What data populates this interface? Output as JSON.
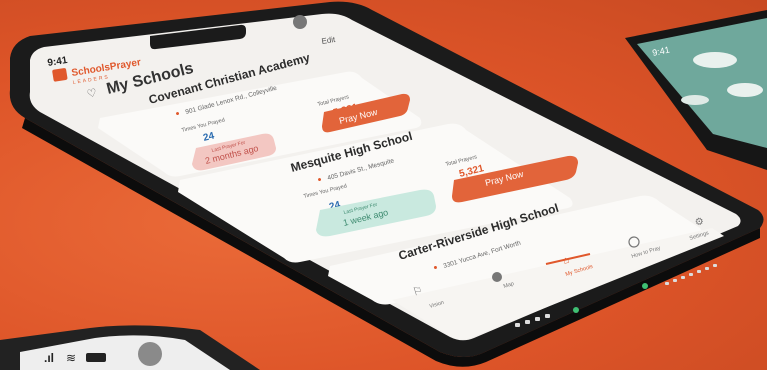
{
  "status_bar": {
    "time": "9:41"
  },
  "app": {
    "brand": "SchoolsPrayer",
    "brand_tagline": "LEADERS",
    "edit_label": "Edit",
    "header": "My Schools"
  },
  "schools": [
    {
      "name": "Covenant Christian Academy",
      "address": "901 Glade Lenox Rd., Colleyville",
      "total_prayers_label": "Total Prayers",
      "total_prayers": "5,321",
      "times_prayed_label": "Times You Prayed",
      "times_prayed": "24",
      "last_prayed_label": "Last Prayer For",
      "last_prayed": "2 months ago",
      "button": "Pray Now"
    },
    {
      "name": "Mesquite High School",
      "address": "405 Davis St., Mesquite",
      "total_prayers_label": "Total Prayers",
      "total_prayers": "5,321",
      "times_prayed_label": "Times You Prayed",
      "times_prayed": "24",
      "last_prayed_label": "Last Prayer For",
      "last_prayed": "1 week ago",
      "button": "Pray Now"
    },
    {
      "name": "Carter-Riverside High School",
      "address": "3301 Yucca Ave, Fort Worth"
    }
  ],
  "tabs": [
    "Vision",
    "Map",
    "My Schools",
    "How to Pray",
    "Settings"
  ],
  "side_phone": {
    "time": "9:41"
  },
  "colors": {
    "background": "#e0582c",
    "accent": "#e0582c",
    "teal": "#6fa89c",
    "pink": "#f3c7c2",
    "mint": "#c9e9df"
  }
}
